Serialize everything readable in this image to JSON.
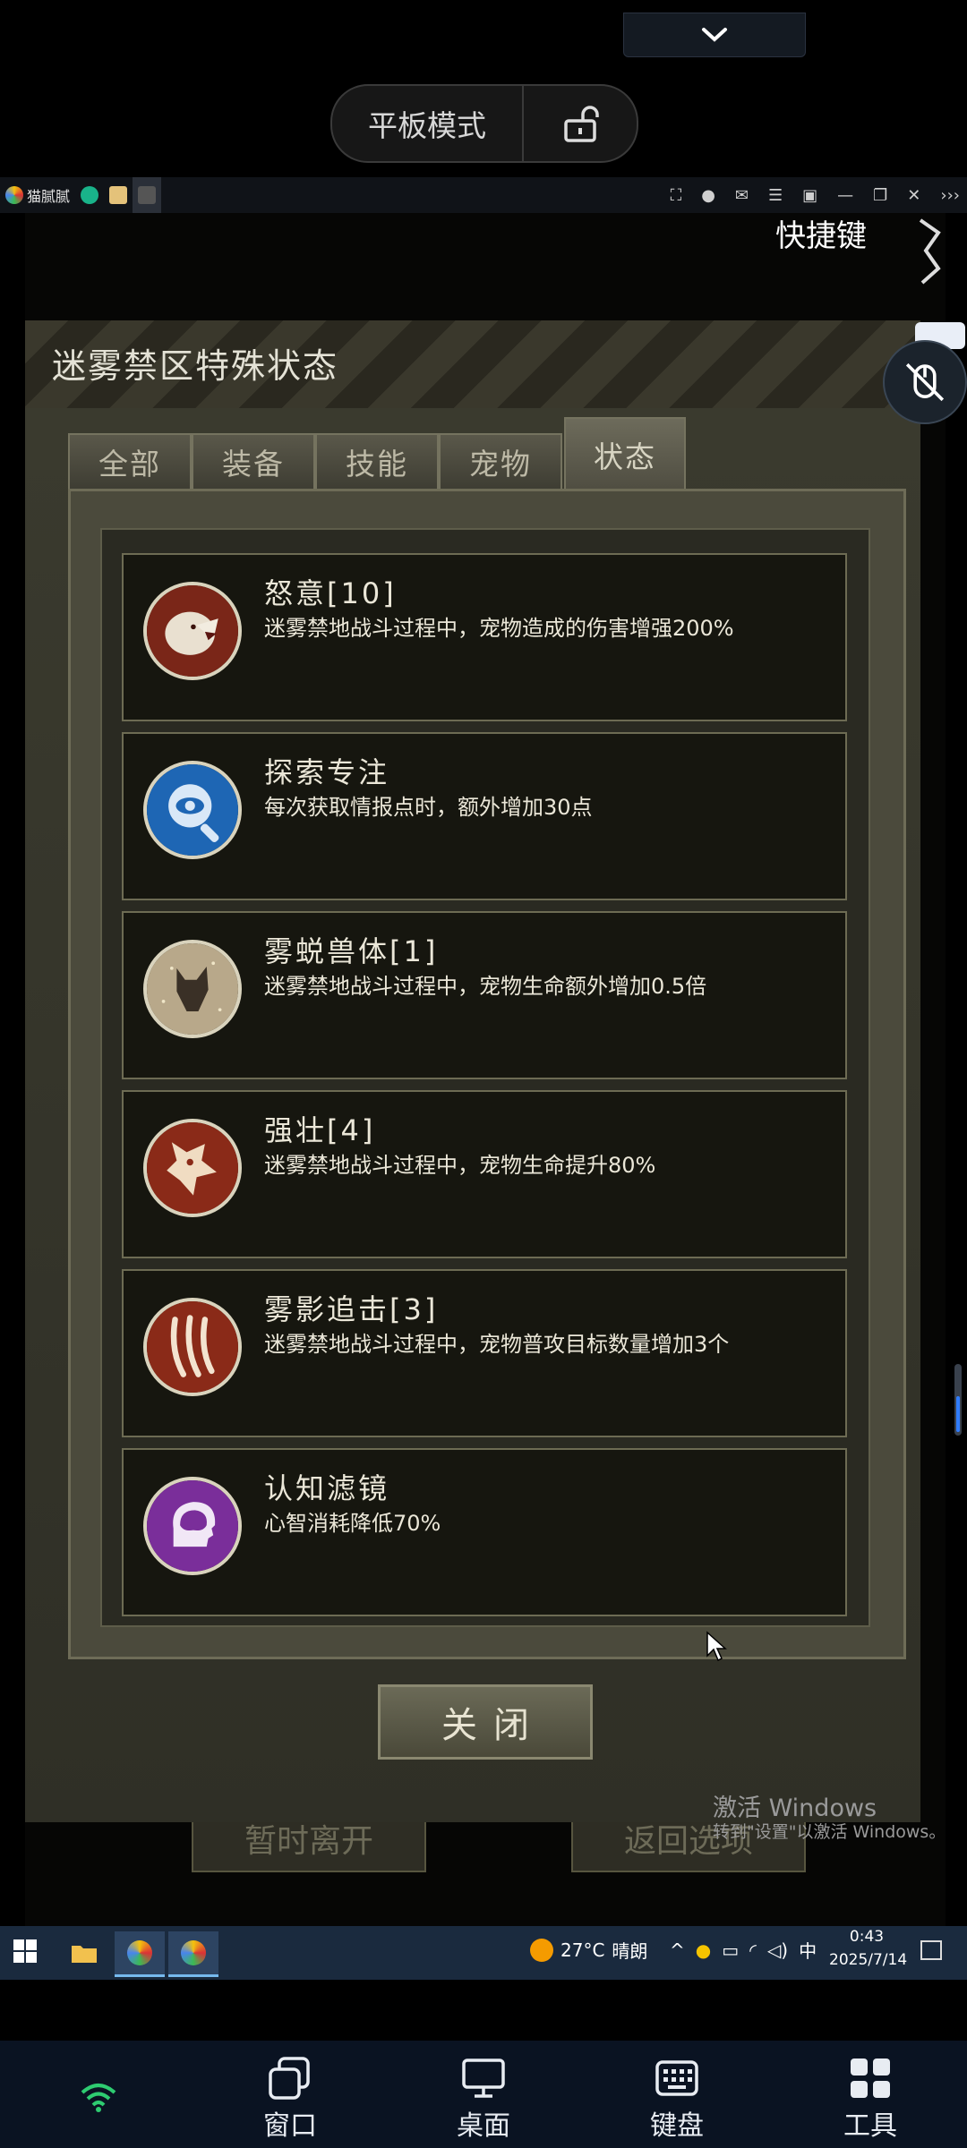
{
  "tablet_mode": {
    "label": "平板模式"
  },
  "emulator": {
    "app_name": "猫腻腻"
  },
  "overlay": {
    "shortcut_label": "快捷键"
  },
  "panel": {
    "title": "迷雾禁区特殊状态",
    "tabs": [
      {
        "label": "全部",
        "active": false
      },
      {
        "label": "装备",
        "active": false
      },
      {
        "label": "技能",
        "active": false
      },
      {
        "label": "宠物",
        "active": false
      },
      {
        "label": "状态",
        "active": true
      }
    ],
    "items": [
      {
        "name": "怒意[10]",
        "desc": "迷雾禁地战斗过程中，宠物造成的伤害增强200%",
        "icon": "roaring-beast-icon"
      },
      {
        "name": "探索专注",
        "desc": "每次获取情报点时，额外增加30点",
        "icon": "eye-magnifier-icon"
      },
      {
        "name": "雾蜕兽体[1]",
        "desc": "迷雾禁地战斗过程中，宠物生命额外增加0.5倍",
        "icon": "mist-wolf-icon"
      },
      {
        "name": "强壮[4]",
        "desc": "迷雾禁地战斗过程中，宠物生命提升80%",
        "icon": "dragon-head-icon"
      },
      {
        "name": "雾影追击[3]",
        "desc": "迷雾禁地战斗过程中，宠物普攻目标数量增加3个",
        "icon": "claw-marks-icon"
      },
      {
        "name": "认知滤镜",
        "desc": "心智消耗降低70%",
        "icon": "brain-head-icon"
      }
    ],
    "close_label": "关闭",
    "bg_buttons": {
      "left": "暂时离开",
      "right": "返回选项"
    }
  },
  "watermark": {
    "line1": "激活 Windows",
    "line2": "转到\"设置\"以激活 Windows。"
  },
  "taskbar": {
    "temperature": "27°C",
    "weather": "晴朗",
    "ime": "中",
    "time": "0:43",
    "date": "2025/7/14"
  },
  "bottom_nav": [
    {
      "label": "窗口",
      "icon": "window-icon"
    },
    {
      "label": "桌面",
      "icon": "desktop-icon"
    },
    {
      "label": "键盘",
      "icon": "keyboard-icon"
    },
    {
      "label": "工具",
      "icon": "tools-icon"
    }
  ],
  "colors": {
    "panel_bg": "#3a3a2e",
    "card_bg": "#16160f",
    "card_border": "#6d6b53",
    "text": "#ebe7d8",
    "taskbar": "#1a2a3e",
    "bottom_nav": "#0a1322"
  }
}
